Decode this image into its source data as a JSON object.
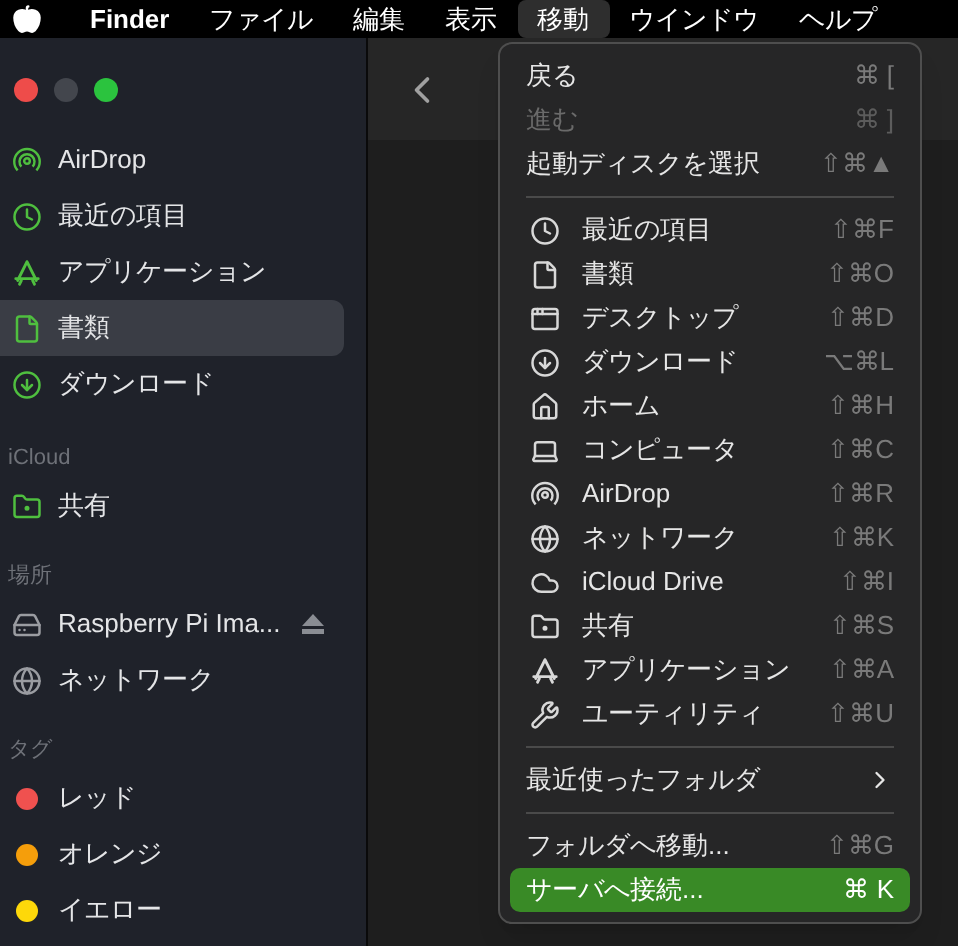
{
  "menu_bar": {
    "items": [
      {
        "label": "Finder",
        "selected": false
      },
      {
        "label": "ファイル",
        "selected": false
      },
      {
        "label": "編集",
        "selected": false
      },
      {
        "label": "表示",
        "selected": false
      },
      {
        "label": "移動",
        "selected": true
      },
      {
        "label": "ウインドウ",
        "selected": false
      },
      {
        "label": "ヘルプ",
        "selected": false
      }
    ]
  },
  "sidebar": {
    "sections": [
      {
        "items": [
          {
            "label": "AirDrop",
            "selected": false
          },
          {
            "label": "最近の項目",
            "selected": false
          },
          {
            "label": "アプリケーション",
            "selected": false
          },
          {
            "label": "書類",
            "selected": true
          },
          {
            "label": "ダウンロード",
            "selected": false
          }
        ]
      },
      {
        "heading": "iCloud",
        "items": [
          {
            "label": "共有",
            "selected": false
          }
        ]
      },
      {
        "heading": "場所",
        "items": [
          {
            "label": "Raspberry Pi Ima...",
            "selected": false,
            "ejectable": true
          },
          {
            "label": "ネットワーク",
            "selected": false
          }
        ]
      },
      {
        "heading": "タグ",
        "items": [
          {
            "label": "レッド",
            "selected": false,
            "color": "#f0514f"
          },
          {
            "label": "オレンジ",
            "selected": false,
            "color": "#f59e0b"
          },
          {
            "label": "イエロー",
            "selected": false,
            "color": "#fdd80a"
          }
        ]
      }
    ]
  },
  "go_menu": {
    "items": [
      {
        "kind": "item",
        "label": "戻る",
        "shortcut": "⌘ [",
        "disabled": false,
        "selected": false
      },
      {
        "kind": "item",
        "label": "進む",
        "shortcut": "⌘ ]",
        "disabled": true,
        "selected": false
      },
      {
        "kind": "item",
        "label": "起動ディスクを選択",
        "shortcut": "⇧⌘▲",
        "disabled": false,
        "selected": false
      },
      {
        "kind": "separator"
      },
      {
        "kind": "icon_item",
        "label": "最近の項目",
        "shortcut": "⇧⌘F",
        "disabled": false,
        "selected": false
      },
      {
        "kind": "icon_item",
        "label": "書類",
        "shortcut": "⇧⌘O",
        "disabled": false,
        "selected": false
      },
      {
        "kind": "icon_item",
        "label": "デスクトップ",
        "shortcut": "⇧⌘D",
        "disabled": false,
        "selected": false
      },
      {
        "kind": "icon_item",
        "label": "ダウンロード",
        "shortcut": "⌥⌘L",
        "disabled": false,
        "selected": false
      },
      {
        "kind": "icon_item",
        "label": "ホーム",
        "shortcut": "⇧⌘H",
        "disabled": false,
        "selected": false
      },
      {
        "kind": "icon_item",
        "label": "コンピュータ",
        "shortcut": "⇧⌘C",
        "disabled": false,
        "selected": false
      },
      {
        "kind": "icon_item",
        "label": "AirDrop",
        "shortcut": "⇧⌘R",
        "disabled": false,
        "selected": false
      },
      {
        "kind": "icon_item",
        "label": "ネットワーク",
        "shortcut": "⇧⌘K",
        "disabled": false,
        "selected": false
      },
      {
        "kind": "icon_item",
        "label": "iCloud Drive",
        "shortcut": "⇧⌘I",
        "disabled": false,
        "selected": false
      },
      {
        "kind": "icon_item",
        "label": "共有",
        "shortcut": "⇧⌘S",
        "disabled": false,
        "selected": false
      },
      {
        "kind": "icon_item",
        "label": "アプリケーション",
        "shortcut": "⇧⌘A",
        "disabled": false,
        "selected": false
      },
      {
        "kind": "icon_item",
        "label": "ユーティリティ",
        "shortcut": "⇧⌘U",
        "disabled": false,
        "selected": false
      },
      {
        "kind": "separator"
      },
      {
        "kind": "submenu",
        "label": "最近使ったフォルダ",
        "disabled": false,
        "selected": false
      },
      {
        "kind": "separator"
      },
      {
        "kind": "item",
        "label": "フォルダへ移動...",
        "shortcut": "⇧⌘G",
        "disabled": false,
        "selected": false
      },
      {
        "kind": "item",
        "label": "サーバへ接続...",
        "shortcut": "⌘ K",
        "disabled": false,
        "selected": true
      }
    ]
  }
}
